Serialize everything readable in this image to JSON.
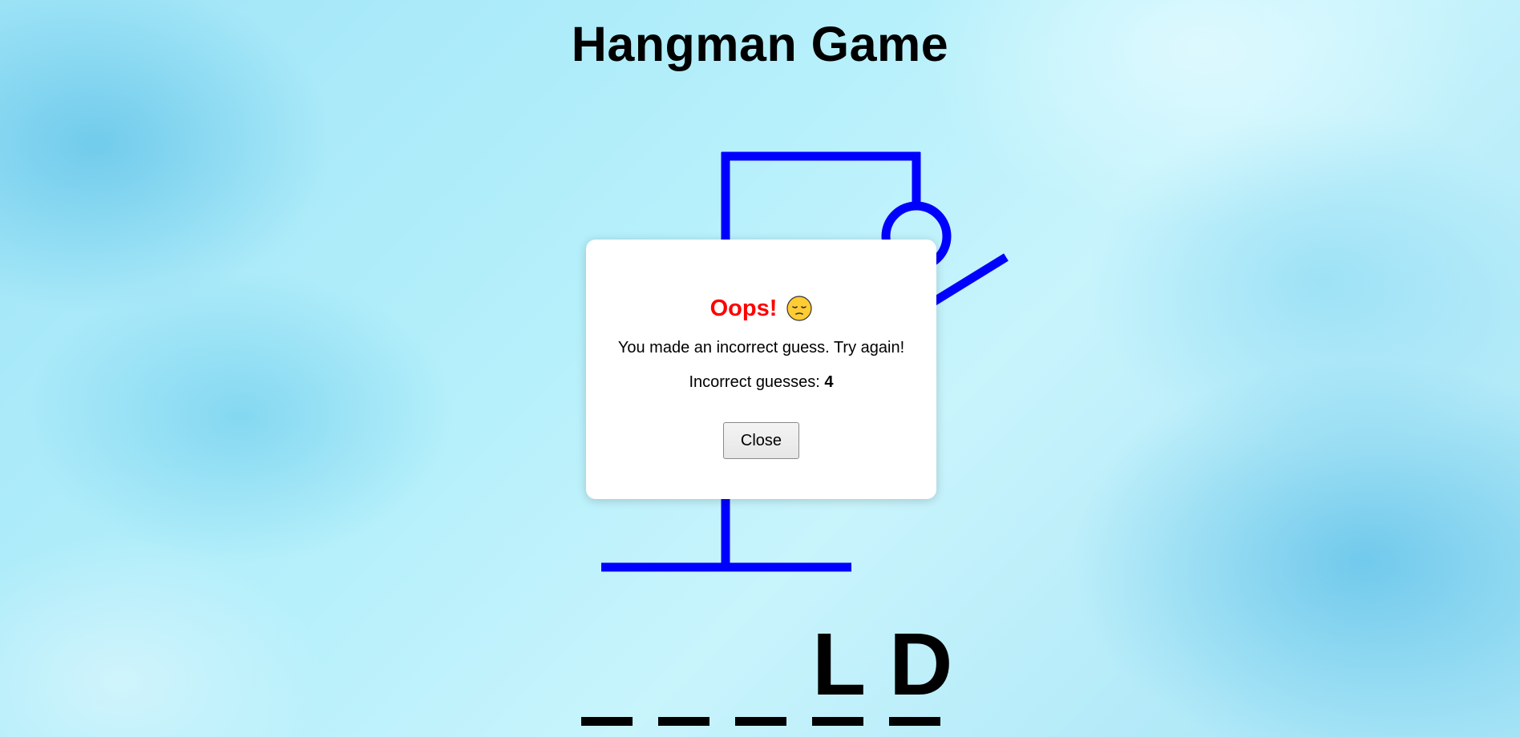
{
  "title": "Hangman Game",
  "word": {
    "slots": [
      {
        "letter": ""
      },
      {
        "letter": ""
      },
      {
        "letter": ""
      },
      {
        "letter": "L"
      },
      {
        "letter": "D"
      }
    ]
  },
  "gallows": {
    "color": "#0000ff",
    "parts_shown": [
      "base",
      "pole",
      "beam",
      "rope",
      "head",
      "arm"
    ]
  },
  "modal": {
    "heading": "Oops!",
    "heading_color": "#ff0000",
    "emoji": "pensive-face-icon",
    "message": "You made an incorrect guess. Try again!",
    "count_label": "Incorrect guesses:",
    "count_value": "4",
    "close_label": "Close"
  }
}
